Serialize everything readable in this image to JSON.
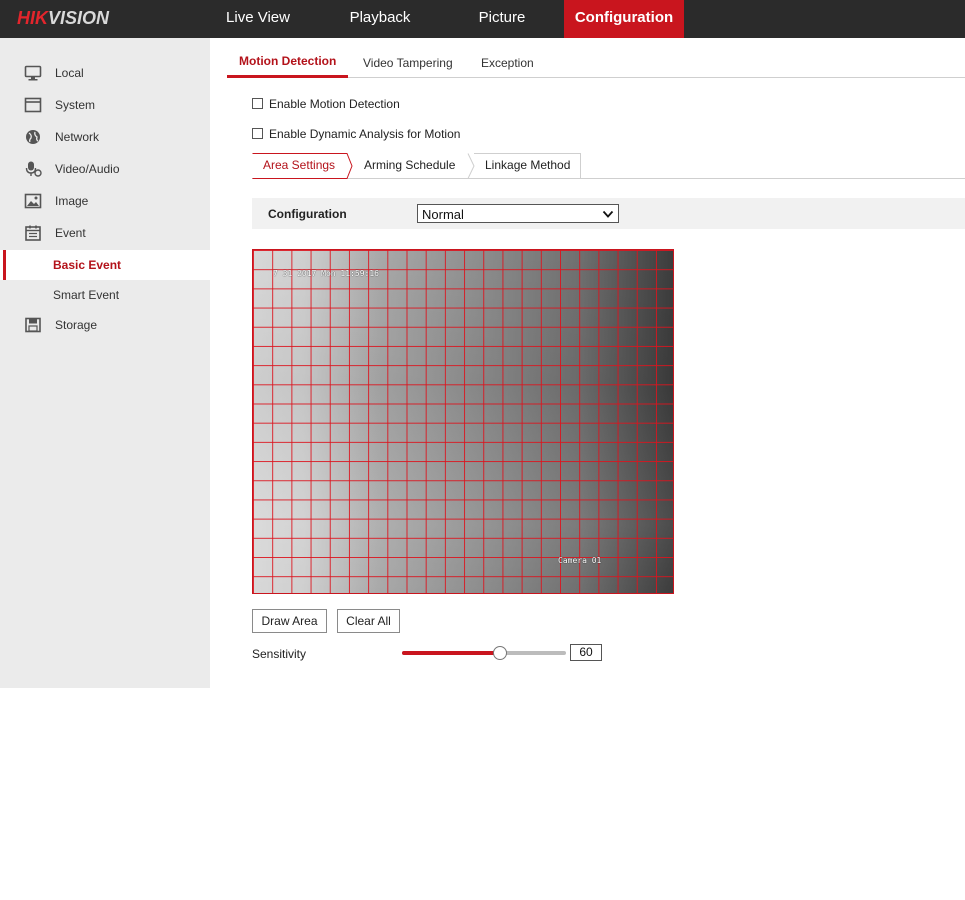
{
  "brand": {
    "logo_red": "HIK",
    "logo_rest": "VISION"
  },
  "topnav": [
    {
      "label": "Live View"
    },
    {
      "label": "Playback"
    },
    {
      "label": "Picture"
    },
    {
      "label": "Configuration",
      "active": true
    }
  ],
  "sidebar": {
    "items": [
      {
        "label": "Local",
        "icon": "monitor-icon"
      },
      {
        "label": "System",
        "icon": "window-icon"
      },
      {
        "label": "Network",
        "icon": "globe-icon"
      },
      {
        "label": "Video/Audio",
        "icon": "microphone-icon"
      },
      {
        "label": "Image",
        "icon": "picture-icon"
      },
      {
        "label": "Event",
        "icon": "calendar-icon"
      }
    ],
    "sub_items": [
      {
        "label": "Basic Event",
        "active": true
      },
      {
        "label": "Smart Event"
      }
    ],
    "storage": {
      "label": "Storage",
      "icon": "storage-icon"
    }
  },
  "tabs": [
    {
      "label": "Motion Detection",
      "active": true
    },
    {
      "label": "Video Tampering"
    },
    {
      "label": "Exception"
    }
  ],
  "options": {
    "enable_motion": {
      "label": "Enable Motion Detection",
      "checked": false
    },
    "enable_dynamic": {
      "label": "Enable Dynamic Analysis for Motion",
      "checked": false
    }
  },
  "subtabs": [
    {
      "label": "Area Settings",
      "active": true
    },
    {
      "label": "Arming Schedule"
    },
    {
      "label": "Linkage Method"
    }
  ],
  "configuration": {
    "label": "Configuration",
    "value": "Normal"
  },
  "video": {
    "osd_datetime": "7 31 2017 Mon 11:59:16",
    "osd_camera": "Camera 01"
  },
  "buttons": {
    "draw_area": "Draw Area",
    "clear_all": "Clear All"
  },
  "sensitivity": {
    "label": "Sensitivity",
    "value": "60",
    "fraction": 0.6
  },
  "colors": {
    "accent": "#c9151e",
    "topbar": "#2b2b2b",
    "sidebar": "#ebebeb"
  }
}
